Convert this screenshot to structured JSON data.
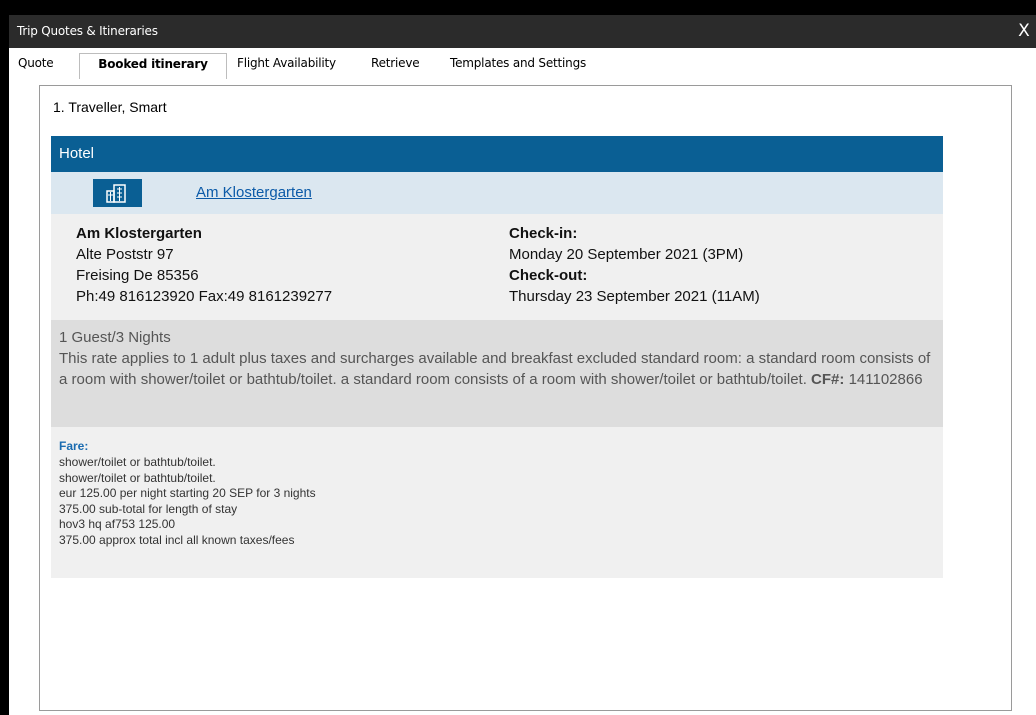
{
  "window": {
    "title": "Trip Quotes & Itineraries",
    "close_label": "X"
  },
  "tabs": [
    {
      "label": "Quote"
    },
    {
      "label": "Booked itinerary"
    },
    {
      "label": "Flight Availability"
    },
    {
      "label": "Retrieve"
    },
    {
      "label": "Templates and Settings"
    }
  ],
  "traveller": "1. Traveller, Smart",
  "hotel": {
    "section_label": "Hotel",
    "link_name": "Am Klostergarten",
    "name": "Am Klostergarten",
    "street": "Alte Poststr 97",
    "city": "Freising De 85356",
    "phone_fax": "Ph:49 816123920 Fax:49 8161239277",
    "checkin_label": "Check-in:",
    "checkin_value": "Monday 20 September 2021 (3PM)",
    "checkout_label": "Check-out:",
    "checkout_value": "Thursday 23 September 2021 (11AM)"
  },
  "rate": {
    "guests_nights": "1 Guest/3 Nights",
    "description": "This rate applies to 1 adult plus taxes and surcharges available and breakfast excluded standard room: a standard room consists of a room with shower/toilet or bathtub/toilet. a standard room consists of a room with shower/toilet or bathtub/toilet.",
    "cf_label": "CF#:",
    "cf_value": "141102866"
  },
  "fare": {
    "title": "Fare:",
    "lines": [
      "shower/toilet or bathtub/toilet.",
      "shower/toilet or bathtub/toilet.",
      "eur 125.00 per night starting 20 SEP for 3 nights",
      "375.00 sub-total for length of stay",
      "hov3 hq af753 125.00",
      "375.00 approx total incl all known taxes/fees"
    ]
  },
  "colors": {
    "hotel_header": "#0a5f94",
    "name_row": "#dbe7f0",
    "fare_title": "#1a6bb0",
    "link": "#0b5aa8"
  },
  "icons": {
    "hotel": "building-icon",
    "close": "close-icon"
  }
}
